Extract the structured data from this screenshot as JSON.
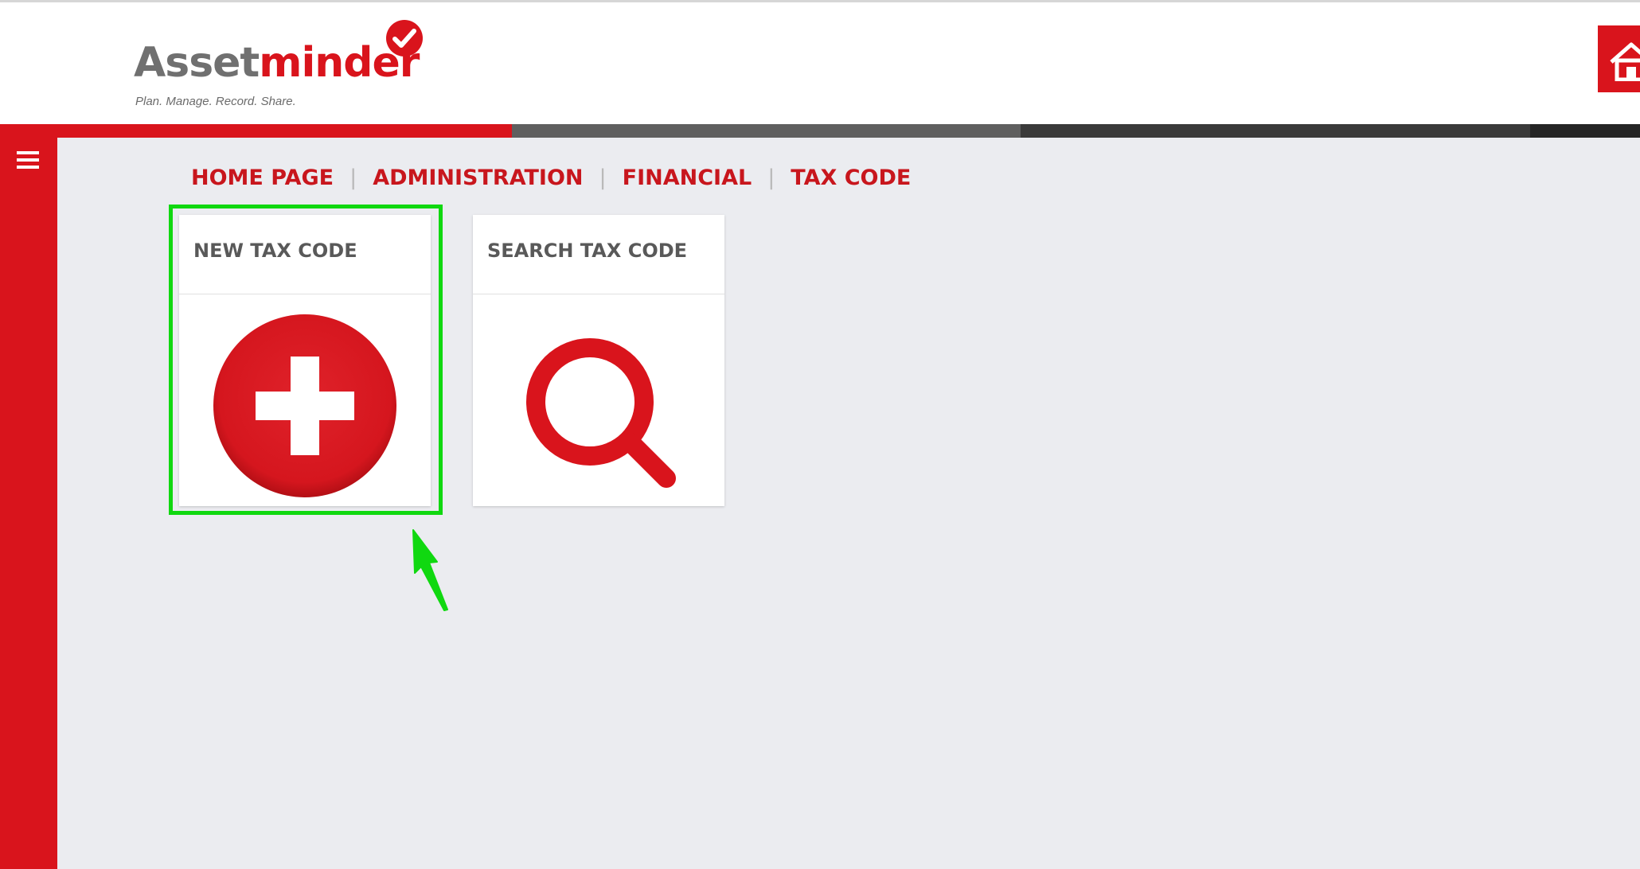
{
  "header": {
    "logo": {
      "brand_part1": "Asset",
      "brand_part2": "minder",
      "tagline": "Plan. Manage. Record. Share."
    },
    "home_icon": "home-icon"
  },
  "sidebar": {
    "menu_icon": "hamburger-menu-icon"
  },
  "breadcrumb": {
    "items": [
      "HOME PAGE",
      "ADMINISTRATION",
      "FINANCIAL",
      "TAX CODE"
    ],
    "separator": "|"
  },
  "tiles": [
    {
      "title": "NEW TAX CODE",
      "icon": "add-circle-icon"
    },
    {
      "title": "SEARCH TAX CODE",
      "icon": "magnifier-icon"
    }
  ],
  "annotation": {
    "highlighted_tile": "NEW TAX CODE",
    "highlight_color": "#10d810"
  },
  "colors": {
    "brand_red": "#d9141c",
    "breadcrumb_red": "#c8161d",
    "logo_gray": "#707070",
    "tile_title": "#595959",
    "page_background": "#ebecf0"
  }
}
